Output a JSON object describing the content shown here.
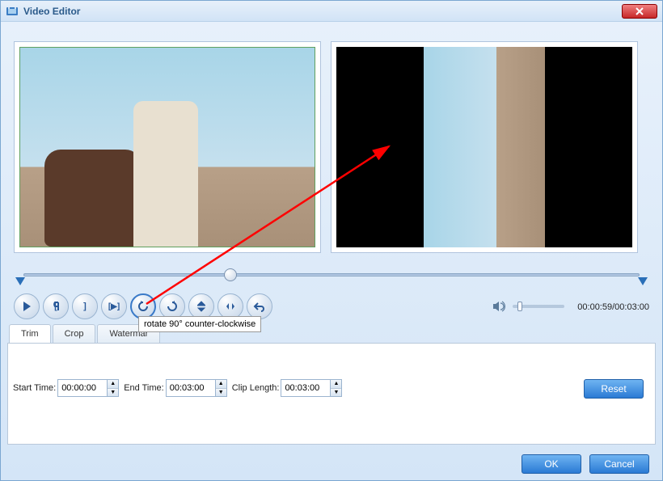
{
  "window": {
    "title": "Video Editor"
  },
  "tooltip_text": "rotate 90° counter-clockwise",
  "time": {
    "current": "00:00:59",
    "total": "00:03:00",
    "separator": "/"
  },
  "tabs": [
    {
      "label": "Trim",
      "active": true
    },
    {
      "label": "Crop",
      "active": false
    },
    {
      "label": "Watermar",
      "active": false
    }
  ],
  "fields": {
    "start_label": "Start Time:",
    "start_value": "00:00:00",
    "end_label": "End Time:",
    "end_value": "00:03:00",
    "clip_label": "Clip Length:",
    "clip_value": "00:03:00"
  },
  "buttons": {
    "reset": "Reset",
    "ok": "OK",
    "cancel": "Cancel"
  },
  "transport_icons": [
    "play-icon",
    "mark-in-icon",
    "mark-out-icon",
    "play-segment-icon",
    "rotate-ccw-icon",
    "rotate-cw-icon",
    "flip-vertical-icon",
    "flip-horizontal-icon",
    "undo-icon"
  ]
}
